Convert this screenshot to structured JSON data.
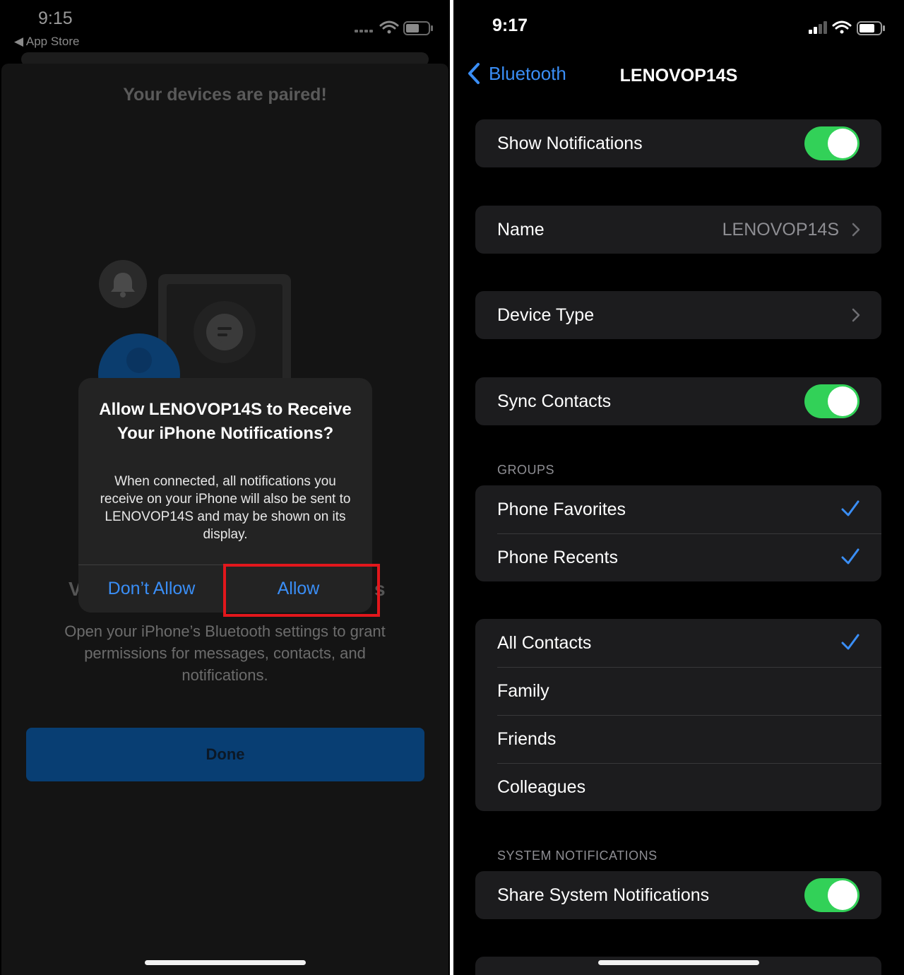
{
  "left": {
    "status_time": "9:15",
    "back_app": "◀ App Store",
    "paired_title": "Your devices are paired!",
    "behind_left": "V",
    "behind_right": "s",
    "permissions_text": "Open your iPhone’s Bluetooth settings to grant permissions for messages, contacts, and notifications.",
    "done_label": "Done",
    "alert": {
      "title": "Allow LENOVOP14S to Receive Your iPhone Notifications?",
      "message": "When connected, all notifications you receive on your iPhone will also be sent to LENOVOP14S and may be shown on its display.",
      "dont_allow": "Don’t Allow",
      "allow": "Allow"
    }
  },
  "right": {
    "status_time": "9:17",
    "back_label": "Bluetooth",
    "title": "LENOVOP14S",
    "show_notifications": {
      "label": "Show Notifications",
      "on": true
    },
    "name": {
      "label": "Name",
      "value": "LENOVOP14S"
    },
    "device_type": {
      "label": "Device Type"
    },
    "sync_contacts": {
      "label": "Sync Contacts",
      "on": true
    },
    "groups_header": "GROUPS",
    "groups": [
      {
        "label": "Phone Favorites",
        "checked": true
      },
      {
        "label": "Phone Recents",
        "checked": true
      }
    ],
    "contacts": [
      {
        "label": "All Contacts",
        "checked": true
      },
      {
        "label": "Family",
        "checked": false
      },
      {
        "label": "Friends",
        "checked": false
      },
      {
        "label": "Colleagues",
        "checked": false
      }
    ],
    "system_header": "SYSTEM NOTIFICATIONS",
    "share_system": {
      "label": "Share System Notifications",
      "on": true
    }
  },
  "colors": {
    "accent_blue": "#3a8ef6",
    "toggle_green": "#32d158",
    "highlight_red": "#e2171c",
    "done_button": "#083e73"
  }
}
